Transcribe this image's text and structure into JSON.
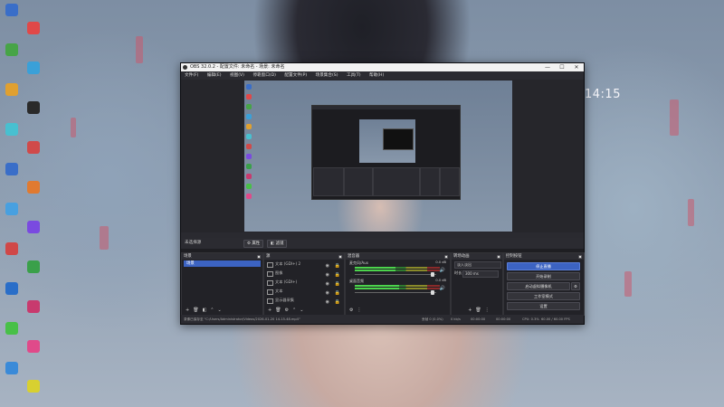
{
  "desktop": {
    "clock": "14:15",
    "icons": [
      "#3a6ec8",
      "#e04848",
      "#47a447",
      "#3aa0d8",
      "#e0a030",
      "#2a2a2a",
      "#48c0d0",
      "#d04a4a",
      "#3a6ec8",
      "#e07a30",
      "#48a0e0",
      "#7a4ae0",
      "#d04848",
      "#3aa04a",
      "#2a6ec8",
      "#c83a6e",
      "#48c048",
      "#e04a8a",
      "#3a8ad8",
      "#d8d030"
    ]
  },
  "obs": {
    "title": "OBS 32.0.2 - 配置文件: 未命名 - 场景: 未命名",
    "window_controls": [
      "—",
      "☐",
      "✕"
    ],
    "menu": [
      "文件(F)",
      "编辑(E)",
      "视图(V)",
      "停靠窗口(D)",
      "配置文件(P)",
      "场景集合(S)",
      "工具(T)",
      "帮助(H)"
    ],
    "scene_bar": {
      "label": "未选择源",
      "properties": "属性",
      "filters": "滤镜"
    },
    "scenes": {
      "title": "场景",
      "items": [
        "场景"
      ]
    },
    "sources": {
      "title": "源",
      "items": [
        "文本 (GDI+) 2",
        "图像",
        "文本 (GDI+)",
        "文本",
        "显示器采集"
      ]
    },
    "mixer": {
      "title": "混音器",
      "channels": [
        {
          "name": "麦克风/Aux",
          "db": "0.0 dB",
          "level": 0.48
        },
        {
          "name": "桌面音频",
          "db": "0.0 dB",
          "level": 0.52
        }
      ]
    },
    "transitions": {
      "title": "转场动画",
      "type": "淡入淡出",
      "duration_label": "时长",
      "duration_value": "300 ms"
    },
    "controls": {
      "title": "控制按钮",
      "buttons": [
        "停止直播",
        "开始录制",
        "启动虚拟摄像机",
        "工作室模式",
        "设置"
      ]
    },
    "status": {
      "recording_path": "录像已保存至 \"C:/Users/Administrator/Videos/2026-01-20 14-15-48.mp4\"",
      "dropped": "丢帧 0 (0.0%)",
      "bitrate": "0 kb/s",
      "live_time": "00:00:00",
      "rec_time": "00:00:00",
      "cpu": "CPU: 0.3%",
      "fps": "60.00 / 60.00 FPS"
    }
  }
}
